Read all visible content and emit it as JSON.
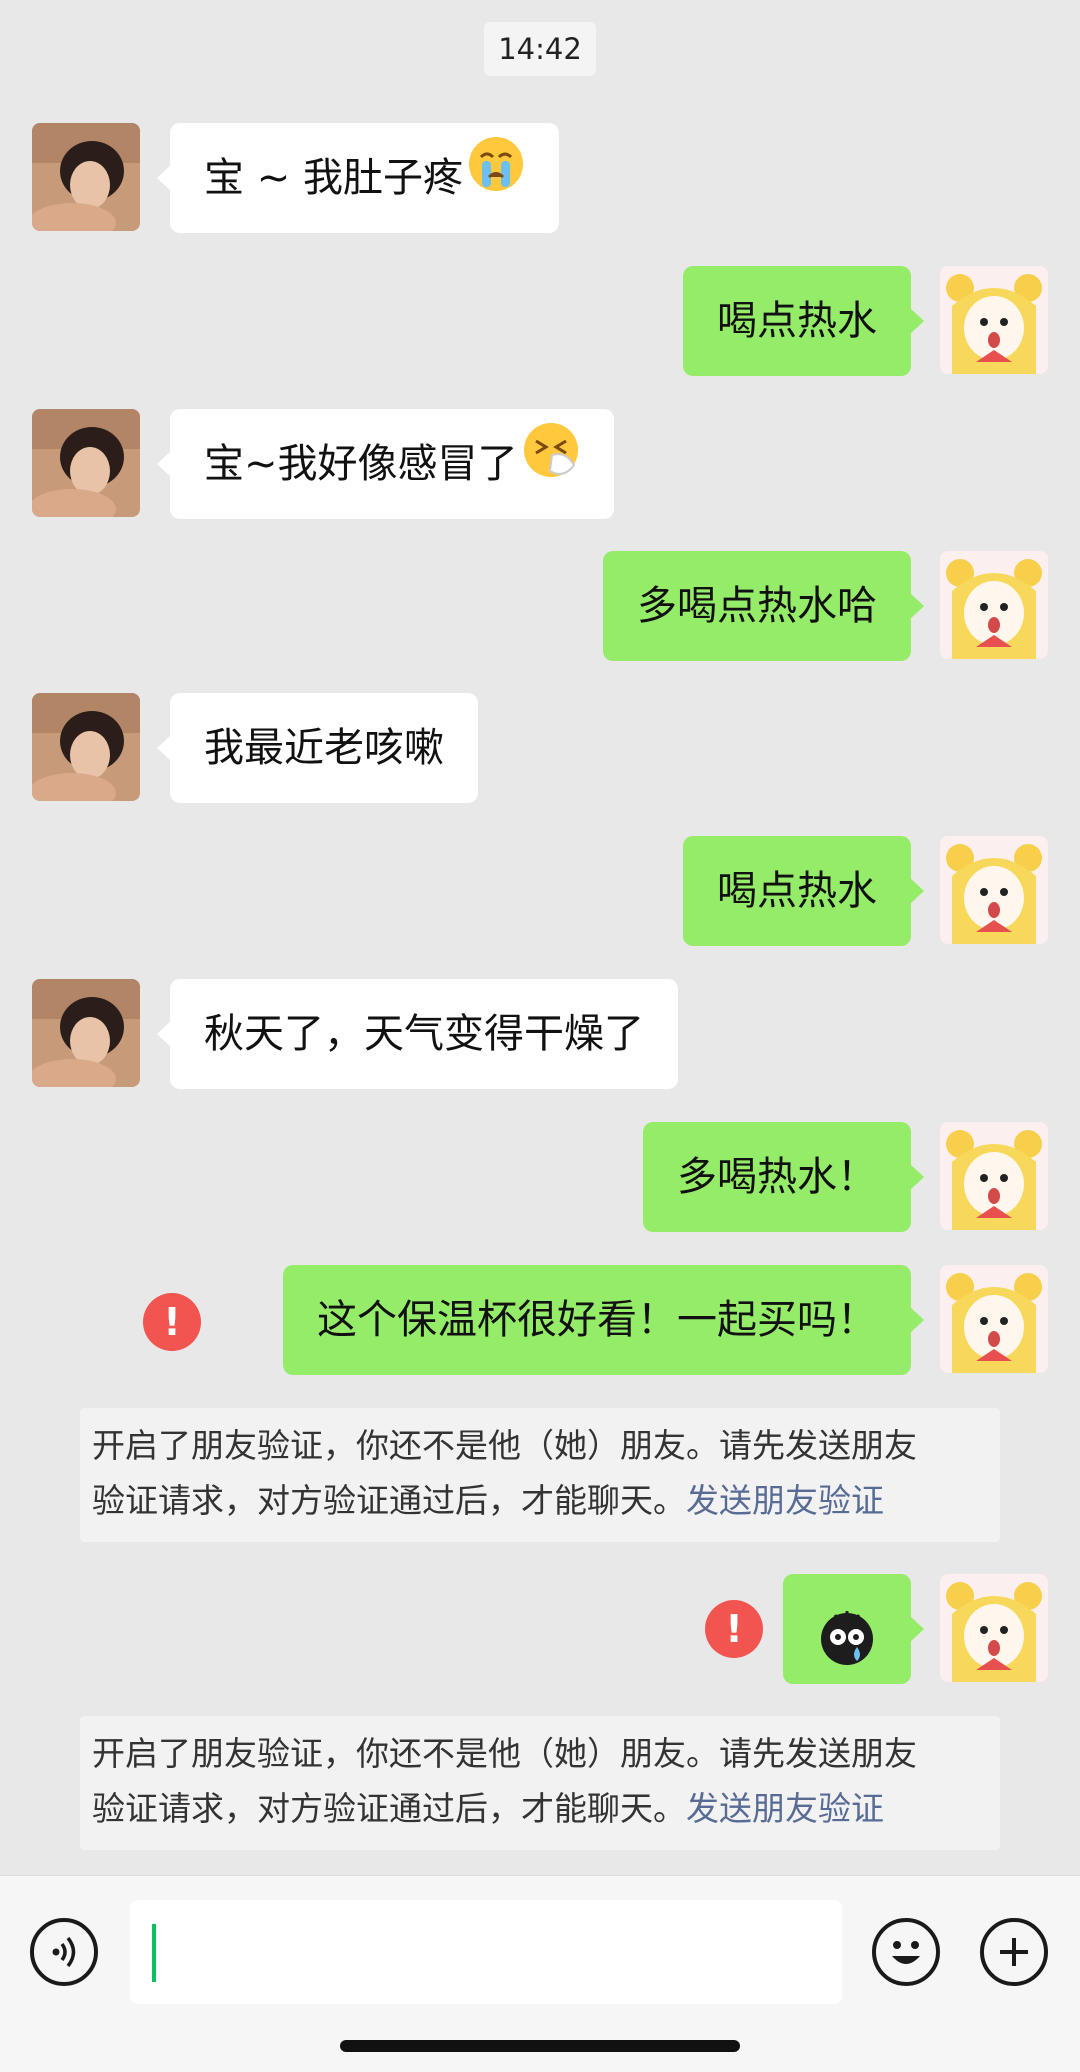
{
  "chat": {
    "timestamp": "14:42",
    "messages": [
      {
        "side": "in",
        "text": "宝 ~ 我肚子疼",
        "emoji": "crying-face"
      },
      {
        "side": "out",
        "text": "喝点热水"
      },
      {
        "side": "in",
        "text": "宝~我好像感冒了",
        "emoji": "sneezing-face"
      },
      {
        "side": "out",
        "text": "多喝点热水哈"
      },
      {
        "side": "in",
        "text": "我最近老咳嗽"
      },
      {
        "side": "out",
        "text": "喝点热水"
      },
      {
        "side": "in",
        "text": "秋天了，天气变得干燥了"
      },
      {
        "side": "out",
        "text": "多喝热水！"
      },
      {
        "side": "out",
        "text": "这个保温杯很好看！一起买吗！",
        "failed": true,
        "error_icon": "!"
      },
      {
        "side": "out",
        "sticker": "dizzy-sticker",
        "failed": true,
        "error_icon": "!"
      }
    ],
    "system_notices": [
      {
        "line1": "开启了朋友验证，你还不是他（她）朋友。请先发送朋友",
        "line2": "验证请求，对方验证通过后，才能聊天。",
        "link": "发送朋友验证"
      },
      {
        "line1": "开启了朋友验证，你还不是他（她）朋友。请先发送朋友",
        "line2": "验证请求，对方验证通过后，才能聊天。",
        "link": "发送朋友验证"
      }
    ]
  },
  "input_bar": {
    "voice_icon": "voice-icon",
    "emoji_icon": "emoji-icon",
    "add_icon": "plus-icon",
    "input_value": ""
  },
  "colors": {
    "background": "#e8e8e8",
    "incoming_bubble": "#ffffff",
    "outgoing_bubble": "#95ec69",
    "error_badge": "#f2544f",
    "link": "#576b95",
    "caret": "#07c160"
  }
}
